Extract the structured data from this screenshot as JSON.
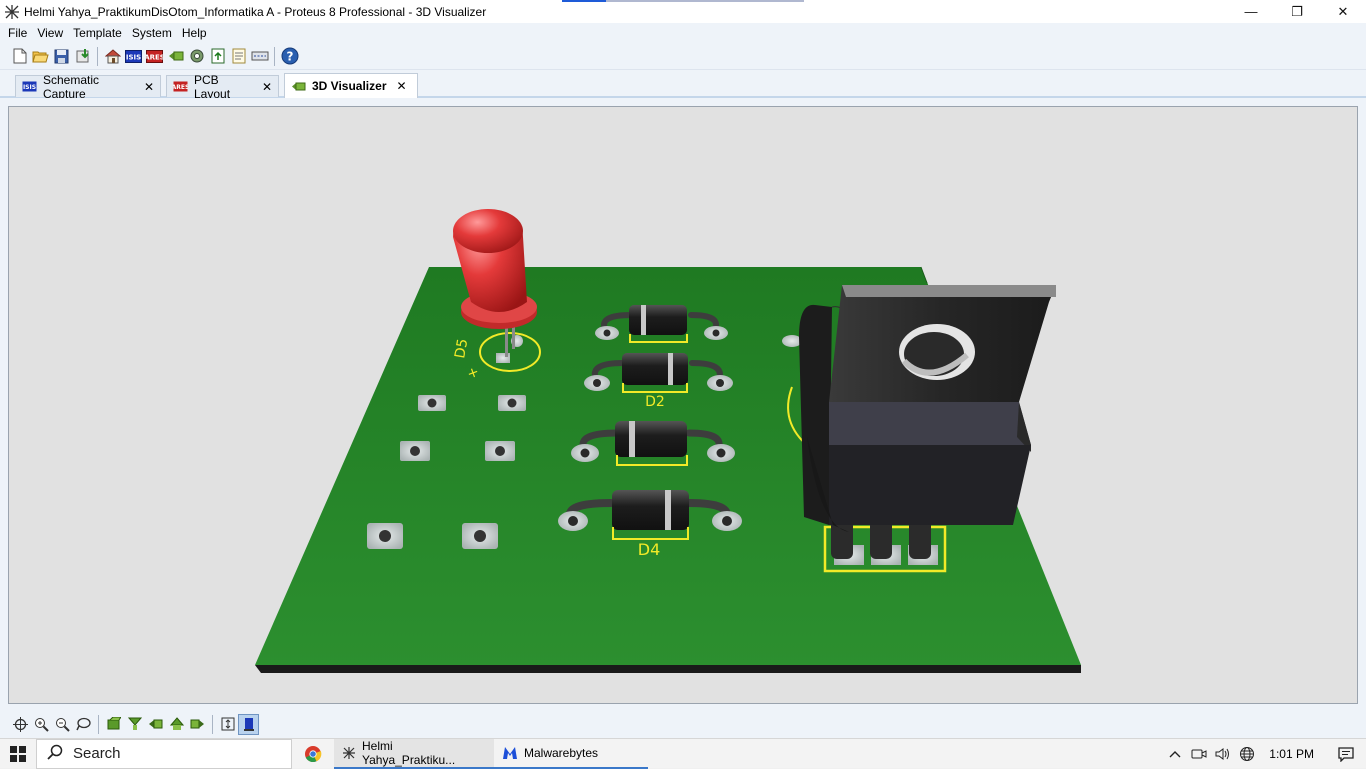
{
  "window": {
    "title": "Helmi Yahya_PraktikumDisOtom_Informatika A - Proteus 8 Professional - 3D Visualizer",
    "controls": {
      "minimize": "—",
      "restore": "❐",
      "close": "✕"
    }
  },
  "menu": {
    "items": [
      "File",
      "View",
      "Template",
      "System",
      "Help"
    ]
  },
  "toolbar": {
    "buttons": [
      "new-file-icon",
      "open-folder-icon",
      "save-icon",
      "import-icon",
      "home-icon",
      "schematic-icon",
      "pcb-icon",
      "3d-visualizer-icon",
      "gerber-icon",
      "bom-icon",
      "design-explorer-icon",
      "netlist-icon",
      "help-icon"
    ]
  },
  "tabs": [
    {
      "label": "Schematic Capture",
      "close": "✕"
    },
    {
      "label": "PCB Layout",
      "close": "✕"
    },
    {
      "label": "3D Visualizer",
      "close": "✕"
    }
  ],
  "board": {
    "labels": {
      "led": "D5",
      "led_polarity": "+",
      "d2": "D2",
      "d4": "D4"
    },
    "colors": {
      "pcb": "#2b8a2e",
      "silkscreen": "#f2ea28",
      "led": "#e23a3a",
      "component_body": "#222222",
      "pad": "#c9cfcf"
    }
  },
  "bottom_toolbar": {
    "buttons": [
      "pan-icon",
      "zoom-in-icon",
      "zoom-out-icon",
      "zoom-fit-icon",
      "view-top-icon",
      "view-front-icon",
      "view-left-icon",
      "view-back-icon",
      "view-right-icon",
      "height-icon",
      "dimension-icon"
    ]
  },
  "taskbar": {
    "search_placeholder": "Search",
    "apps": [
      {
        "label": "Helmi Yahya_Praktiku..."
      },
      {
        "label": "Malwarebytes"
      }
    ],
    "clock": "1:01 PM"
  }
}
